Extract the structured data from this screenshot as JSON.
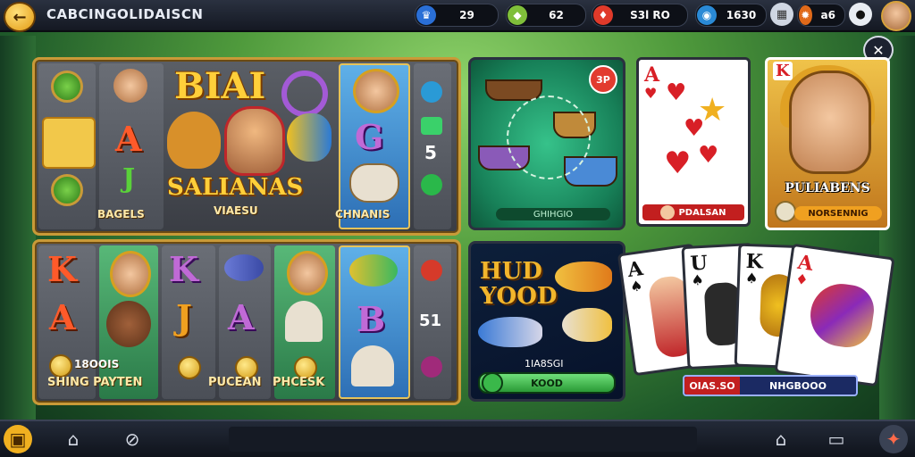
{
  "topbar": {
    "back_icon": "arrow-left-icon",
    "title": "CABCINGOLIDAISCN",
    "currencies": [
      {
        "icon": "crown-icon",
        "value": "29"
      },
      {
        "icon": "gem-green-icon",
        "value": "62"
      },
      {
        "icon": "ruby-icon",
        "value": "S3l RO"
      },
      {
        "icon": "globe-icon",
        "value": "1630"
      },
      {
        "icon": "fire-icon",
        "value": "a6"
      }
    ],
    "extra_icons": [
      "settings-icon",
      "chip-icon"
    ],
    "avatar": "player-avatar"
  },
  "slot_top": {
    "title": "BIAI",
    "banner": "SALIANAS",
    "sub_banner": "VIAESU",
    "reel1_caption": "BAGELS",
    "reel_right_caption": "CHNANIS",
    "reel_left_top_letters": [
      "A",
      "J"
    ],
    "blue_reel_letter": "G",
    "side_number": "5"
  },
  "slot_bottom": {
    "letters": [
      "K",
      "A",
      "K",
      "J",
      "A",
      "B"
    ],
    "counter": "18OOIS",
    "caption_left": "SHING PAYTEN",
    "caption_mid": "PUCEAN",
    "caption_right": "PHCESK",
    "side_number": "51"
  },
  "board_game": {
    "badge": "3P",
    "caption": "GHIHGIO"
  },
  "card_single": {
    "rank": "A",
    "label": "PDALSAN"
  },
  "hero_card": {
    "rank": "K",
    "title": "PULIABENS",
    "label": "NORSENNIG"
  },
  "hud_panel": {
    "title_line1": "HUD",
    "title_line2": "YOOD",
    "number": "1IA8SGI",
    "button": "KOOD"
  },
  "card_fan": {
    "ranks": [
      "A",
      "U",
      "K",
      "A"
    ],
    "left_label": "OIAS.SO",
    "right_label": "NHGBOOO"
  },
  "bottombar": {
    "icons": [
      "gift-icon",
      "home-icon",
      "no-signal-icon",
      "house-user-icon",
      "screen-icon",
      "joystick-icon"
    ]
  },
  "colors": {
    "gold": "#c99a38",
    "accent_red": "#d81f26",
    "accent_green": "#2a9a36",
    "topbar": "#141822"
  }
}
